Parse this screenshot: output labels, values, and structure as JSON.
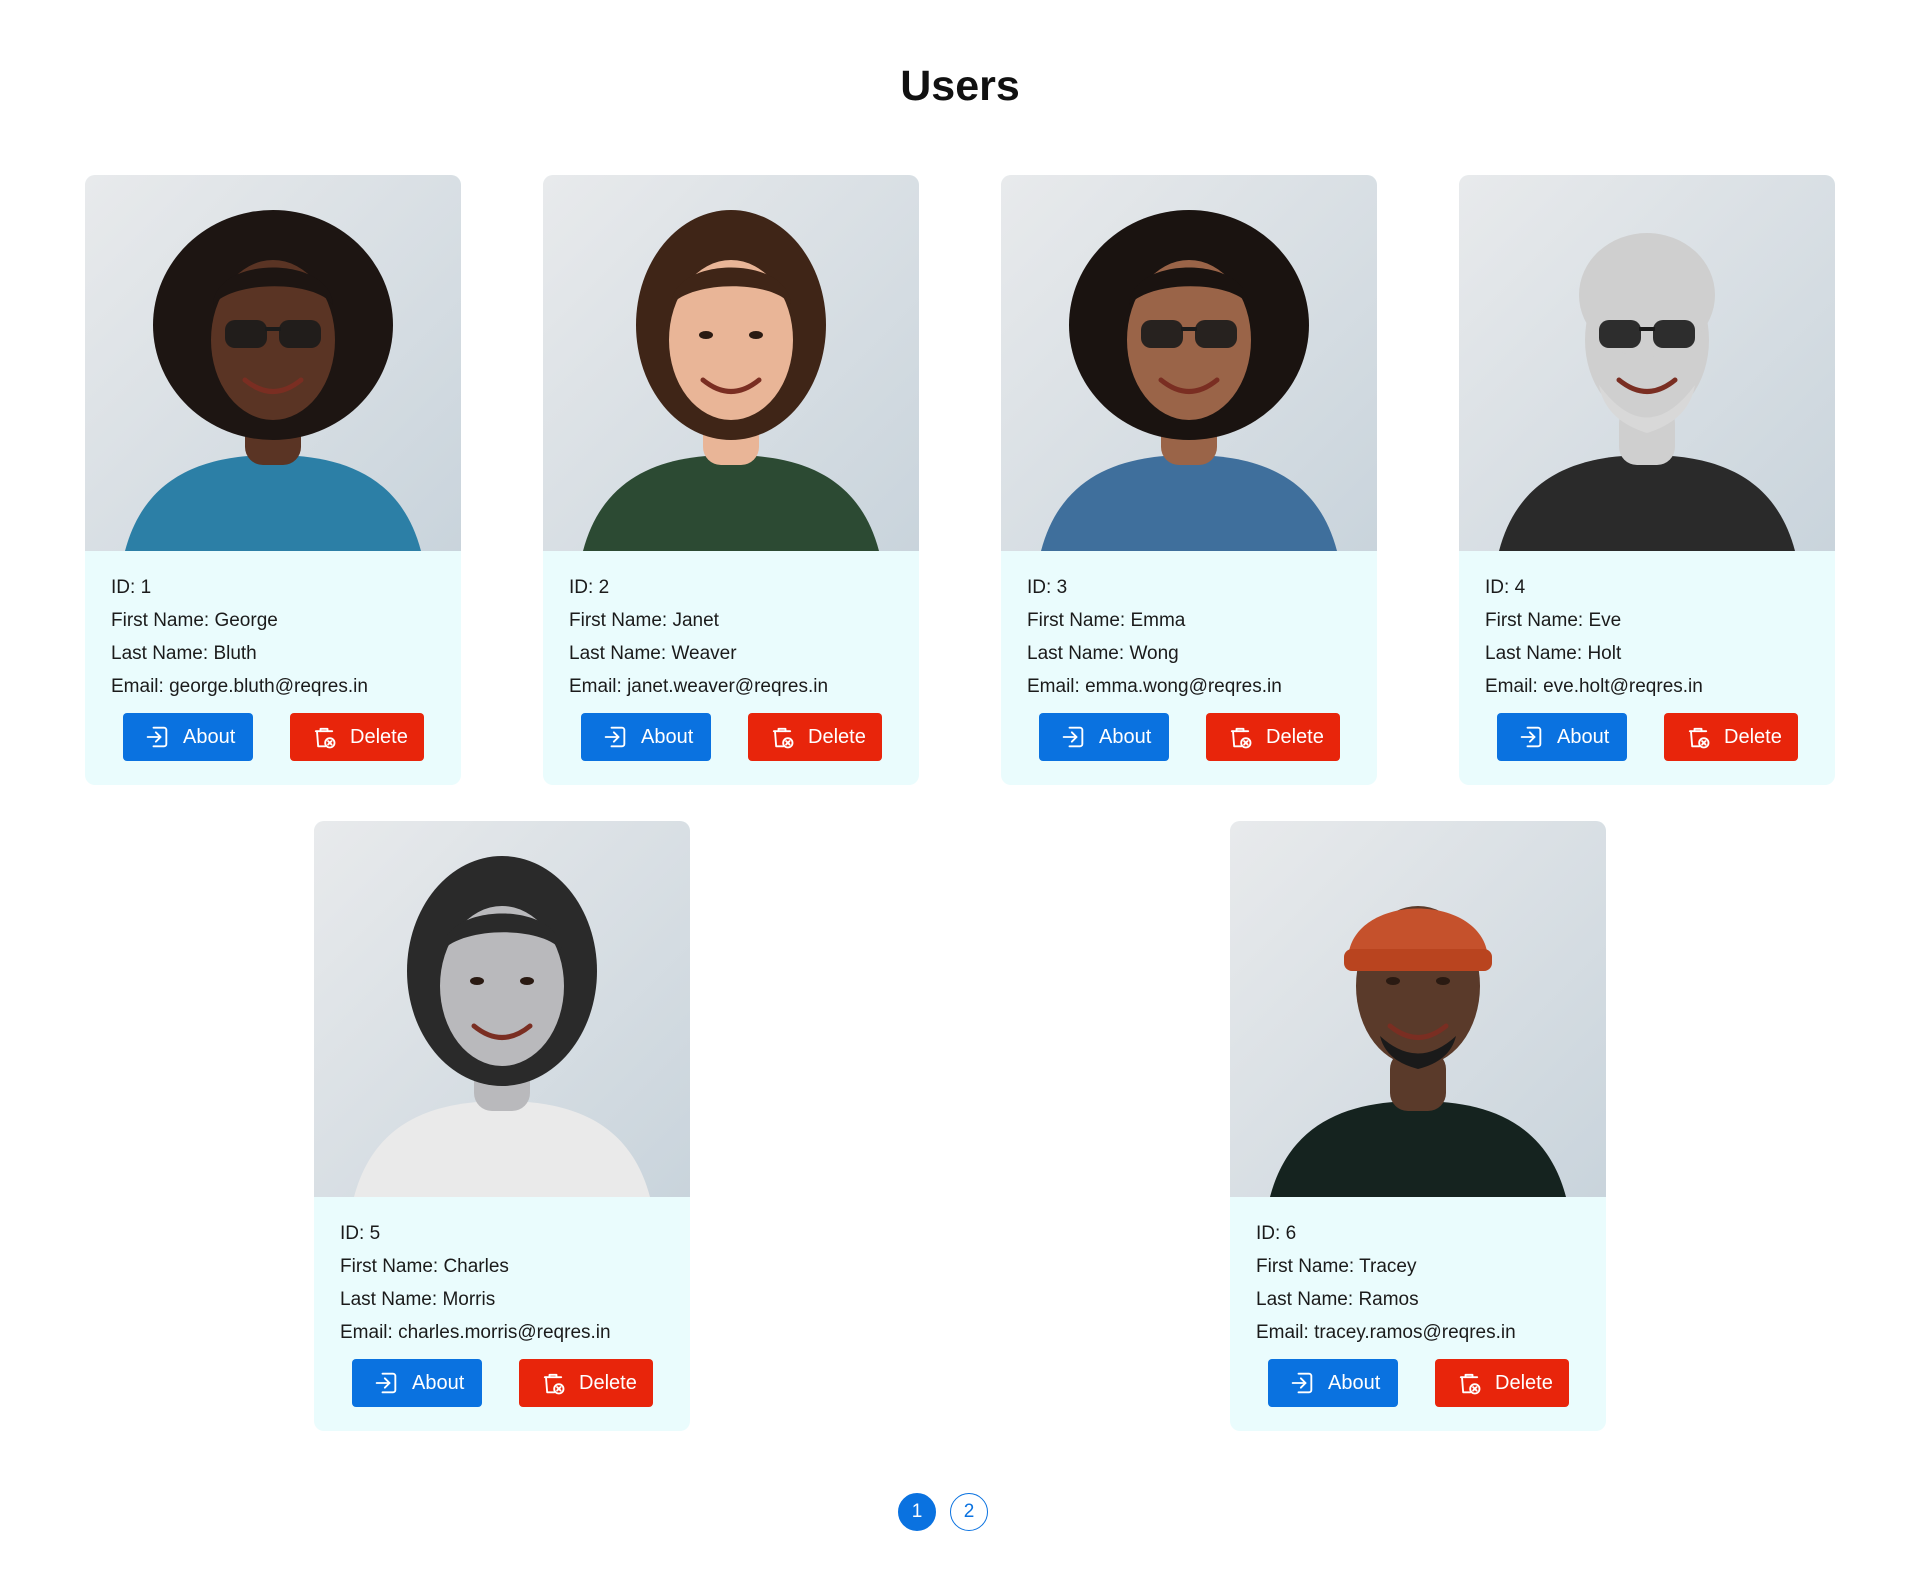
{
  "page": {
    "title": "Users"
  },
  "labels": {
    "id": "ID: ",
    "first_name": "First Name: ",
    "last_name": "Last Name: ",
    "email": "Email: ",
    "about": "About",
    "delete": "Delete"
  },
  "users": [
    {
      "id": "1",
      "first_name": "George",
      "last_name": "Bluth",
      "email": "george.bluth@reqres.in"
    },
    {
      "id": "2",
      "first_name": "Janet",
      "last_name": "Weaver",
      "email": "janet.weaver@reqres.in"
    },
    {
      "id": "3",
      "first_name": "Emma",
      "last_name": "Wong",
      "email": "emma.wong@reqres.in"
    },
    {
      "id": "4",
      "first_name": "Eve",
      "last_name": "Holt",
      "email": "eve.holt@reqres.in"
    },
    {
      "id": "5",
      "first_name": "Charles",
      "last_name": "Morris",
      "email": "charles.morris@reqres.in"
    },
    {
      "id": "6",
      "first_name": "Tracey",
      "last_name": "Ramos",
      "email": "tracey.ramos@reqres.in"
    }
  ],
  "pagination": {
    "pages": [
      "1",
      "2"
    ],
    "current": "1"
  },
  "colors": {
    "primary": "#0a72e0",
    "danger": "#e8250b",
    "card_bg": "#eafcfd"
  }
}
